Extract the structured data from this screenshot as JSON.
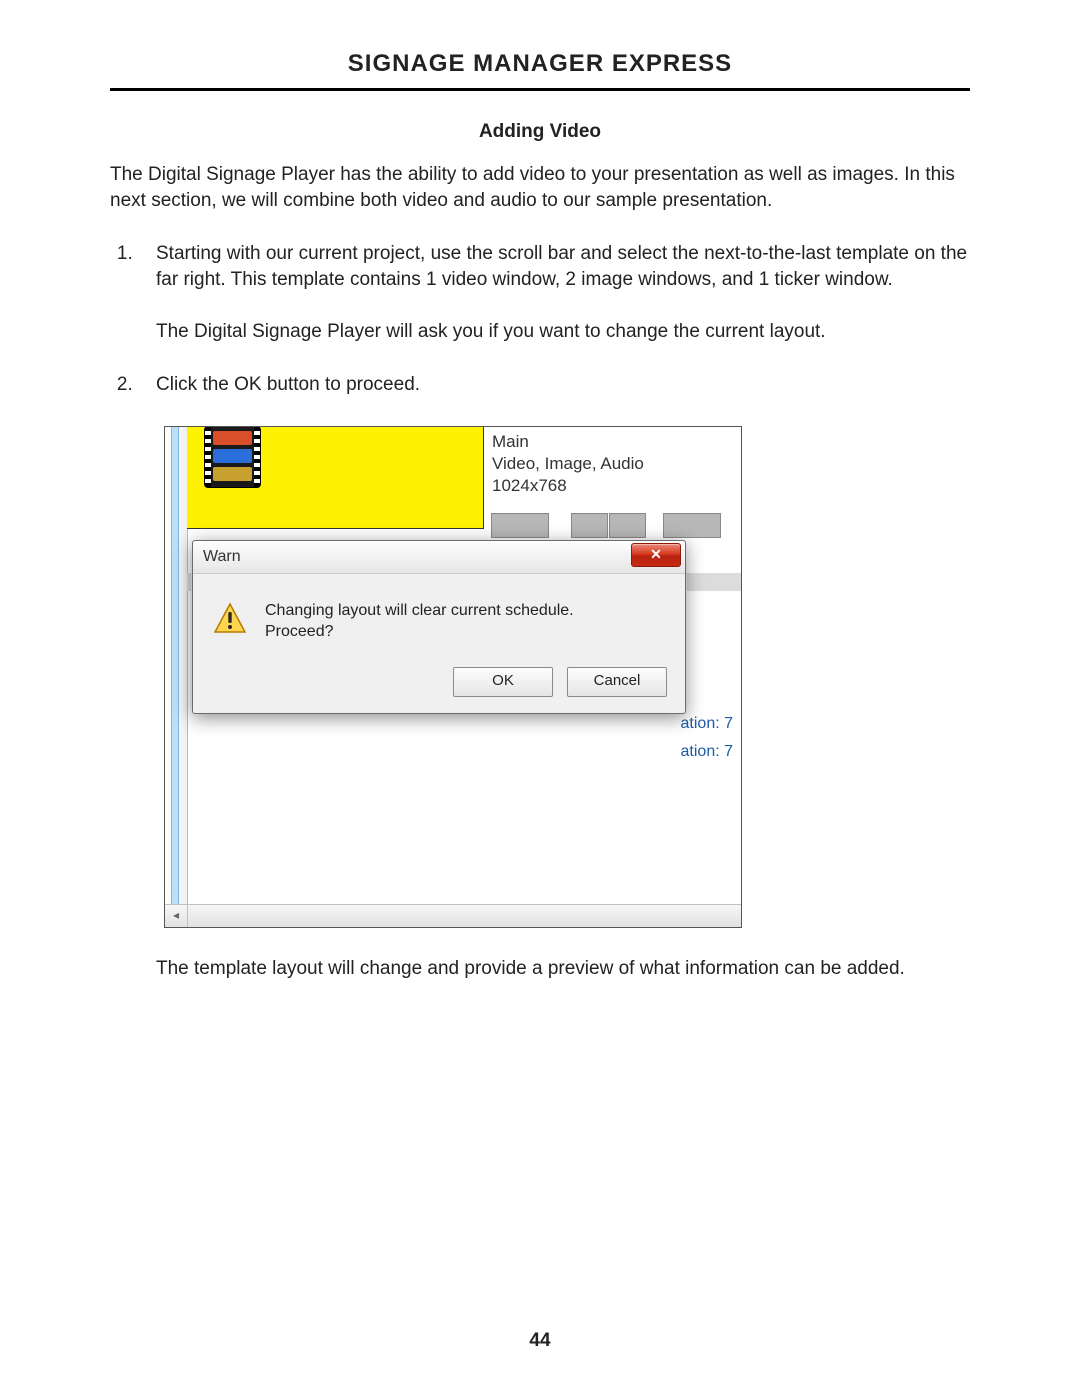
{
  "header": {
    "title": "SIGNAGE MANAGER EXPRESS"
  },
  "section": {
    "title": "Adding Video"
  },
  "intro": "The Digital Signage Player has the ability to add video to your presentation as well as images.  In this next section, we will combine both video and audio to our sample presentation.",
  "steps": {
    "s1a": "Starting with our current project, use the scroll bar and select the next-to-the-last template on the far right.  This template contains 1 video window, 2 image windows, and 1 ticker window.",
    "s1b": "The Digital Signage Player will ask you if you want to change the current layout.",
    "s2": "Click the OK button to proceed."
  },
  "screenshot": {
    "info": {
      "line1": "Main",
      "line2": "Video, Image, Audio",
      "line3": "1024x768"
    },
    "dialog": {
      "title": "Warn",
      "close": "✕",
      "msg1": "Changing layout will clear current schedule.",
      "msg2": "Proceed?",
      "ok": "OK",
      "cancel": "Cancel"
    },
    "frag": "ation: 7",
    "scroll_left": "◂"
  },
  "after": "The template layout will change and provide a preview of what information can be added.",
  "page_number": "44"
}
